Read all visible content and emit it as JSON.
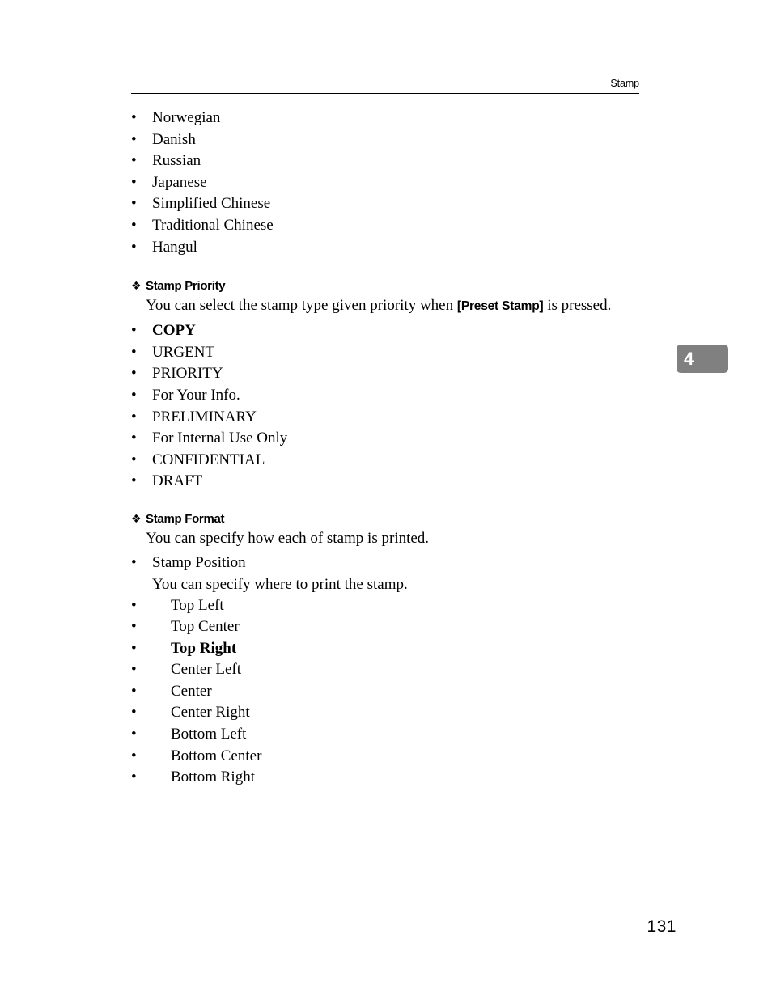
{
  "header": {
    "title": "Stamp"
  },
  "chapter_tab": {
    "number": "4",
    "color": "#808080"
  },
  "page_number": "131",
  "language_list": [
    "Norwegian",
    "Danish",
    "Russian",
    "Japanese",
    "Simplified Chinese",
    "Traditional Chinese",
    "Hangul"
  ],
  "stamp_priority": {
    "heading": "Stamp Priority",
    "bullet_glyph": "❖",
    "description_before": "You can select the stamp type given priority when ",
    "description_key": "[Preset Stamp]",
    "description_after": " is pressed.",
    "items": [
      {
        "label": "COPY",
        "bold": true
      },
      {
        "label": "URGENT",
        "bold": false
      },
      {
        "label": "PRIORITY",
        "bold": false
      },
      {
        "label": "For Your Info.",
        "bold": false
      },
      {
        "label": "PRELIMINARY",
        "bold": false
      },
      {
        "label": "For Internal Use Only",
        "bold": false
      },
      {
        "label": "CONFIDENTIAL",
        "bold": false
      },
      {
        "label": "DRAFT",
        "bold": false
      }
    ]
  },
  "stamp_format": {
    "heading": "Stamp Format",
    "bullet_glyph": "❖",
    "description": "You can specify how each of stamp is printed.",
    "stamp_position": {
      "label": "Stamp Position",
      "description": "You can specify where to print the stamp.",
      "options": [
        {
          "label": "Top Left",
          "bold": false
        },
        {
          "label": "Top Center",
          "bold": false
        },
        {
          "label": "Top Right",
          "bold": true
        },
        {
          "label": "Center Left",
          "bold": false
        },
        {
          "label": "Center",
          "bold": false
        },
        {
          "label": "Center Right",
          "bold": false
        },
        {
          "label": "Bottom Left",
          "bold": false
        },
        {
          "label": "Bottom Center",
          "bold": false
        },
        {
          "label": "Bottom Right",
          "bold": false
        }
      ]
    }
  },
  "bullet_glyph": "•"
}
